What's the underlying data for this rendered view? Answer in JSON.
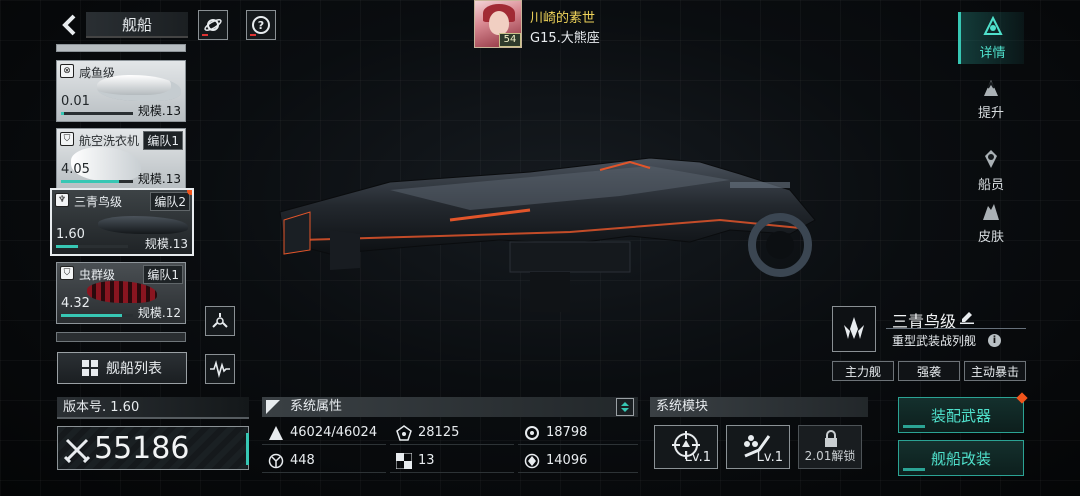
{
  "header": {
    "title": "舰船"
  },
  "player": {
    "name": "川崎的素世",
    "guild": "G15.大熊座",
    "level": "54"
  },
  "ship_list": [
    {
      "name": "咸鱼级",
      "team": "",
      "power": "0.01",
      "scale": "规模.13",
      "style": "light"
    },
    {
      "name": "航空洗衣机",
      "team": "编队1",
      "power": "4.05",
      "scale": "规模.13",
      "style": "light"
    },
    {
      "name": "三青鸟级",
      "team": "编队2",
      "power": "1.60",
      "scale": "规模.13",
      "style": "selected"
    },
    {
      "name": "虫群级",
      "team": "编队1",
      "power": "4.32",
      "scale": "规模.12",
      "style": "dark"
    }
  ],
  "ship_list_button": "舰船列表",
  "right_nav": [
    {
      "label": "详情",
      "icon": "details-icon",
      "active": true
    },
    {
      "label": "提升",
      "icon": "upgrade-icon",
      "active": false
    },
    {
      "label": "船员",
      "icon": "crew-icon",
      "active": false
    },
    {
      "label": "皮肤",
      "icon": "skin-icon",
      "active": false
    }
  ],
  "ship_info": {
    "name": "三青鸟级",
    "role": "重型武装战列舰",
    "tags": [
      "主力舰",
      "强袭",
      "主动暴击"
    ]
  },
  "version": "版本号. 1.60",
  "power": "55186",
  "attributes": {
    "title": "系统属性",
    "cells": [
      {
        "icon": "hull-icon",
        "value": "46024/46024"
      },
      {
        "icon": "armor-icon",
        "value": "28125"
      },
      {
        "icon": "shield-icon",
        "value": "18798"
      },
      {
        "icon": "speed-icon",
        "value": "448"
      },
      {
        "icon": "checker-icon",
        "value": "13"
      },
      {
        "icon": "target-icon",
        "value": "14096"
      }
    ]
  },
  "modules": {
    "title": "系统模块",
    "slots": [
      {
        "icon": "crosshair-icon",
        "level": "Lv.1"
      },
      {
        "icon": "turret-icon",
        "level": "Lv.1"
      },
      {
        "icon": "lock-icon",
        "locked_text": "2.01解锁"
      }
    ]
  },
  "actions": {
    "equip": "装配武器",
    "modify": "舰船改装"
  },
  "colors": {
    "accent": "#37c7b4",
    "alert": "#f2541b",
    "player_name": "#f0d45a"
  }
}
